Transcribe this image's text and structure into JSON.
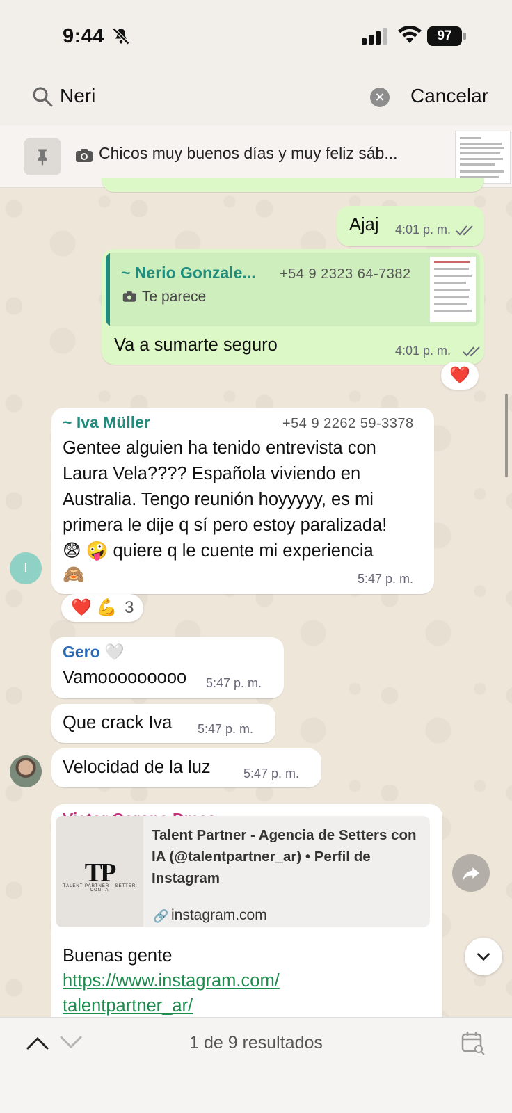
{
  "status_bar": {
    "time": "9:44",
    "battery": "97"
  },
  "search": {
    "query": "Neri",
    "cancel_label": "Cancelar"
  },
  "pinned": {
    "text": "Chicos muy buenos días y muy feliz sáb..."
  },
  "messages": [
    {
      "id": "m1",
      "type": "outgoing",
      "text": "Ajaj",
      "time": "4:01 p. m."
    },
    {
      "id": "m2",
      "type": "outgoing",
      "quote": {
        "sender": "~ Nerio Gonzale...",
        "phone": "+54 9 2323 64-7382",
        "caption": "Te parece"
      },
      "text": "Va a sumarte seguro",
      "time": "4:01 p. m.",
      "reaction": "❤️"
    },
    {
      "id": "m3",
      "type": "incoming",
      "sender": "~ Iva Müller",
      "sender_color": "#1f8c7d",
      "phone": "+54 9 2262 59-3378",
      "lines": [
        "Gentee alguien ha tenido entrevista con",
        "Laura Vela???? Española viviendo en",
        "Australia. Tengo reunión hoyyyyy, es mi",
        "primera le dije q sí pero estoy paralizada!",
        "😨 🤪  quiere q le cuente mi experiencia",
        "🙈"
      ],
      "time": "5:47 p. m.",
      "avatar_letter": "I",
      "reactions": {
        "emojis": "❤️ 💪",
        "count": "3"
      }
    },
    {
      "id": "m4",
      "type": "incoming",
      "sender": "Gero 🤍",
      "sender_color": "#2a6ab5",
      "text": "Vamooooooooo",
      "time": "5:47 p. m."
    },
    {
      "id": "m5",
      "type": "incoming",
      "text": "Que crack Iva",
      "time": "5:47 p. m."
    },
    {
      "id": "m6",
      "type": "incoming",
      "text": "Velocidad de la luz",
      "time": "5:47 p. m."
    },
    {
      "id": "m7",
      "type": "incoming",
      "sender": "Victor Corona Dmca",
      "sender_color": "#c2317a",
      "link_preview": {
        "title": "Talent Partner - Agencia de Setters con IA (@talentpartner_ar) • Perfil de Instagram",
        "domain": "instagram.com",
        "logo_text": "TP",
        "logo_sub": "TALENT PARTNER · SETTER CON IA"
      },
      "text": "Buenas gente",
      "url_line1": "https://www.instagram.com/",
      "url_line2": "talentpartner_ar/"
    }
  ],
  "footer": {
    "results": "1 de 9 resultados"
  },
  "colors": {
    "outgoing": "#dcf8c6",
    "incoming": "#ffffff",
    "accent": "#1f8c7d",
    "heart": "#e0262e"
  }
}
